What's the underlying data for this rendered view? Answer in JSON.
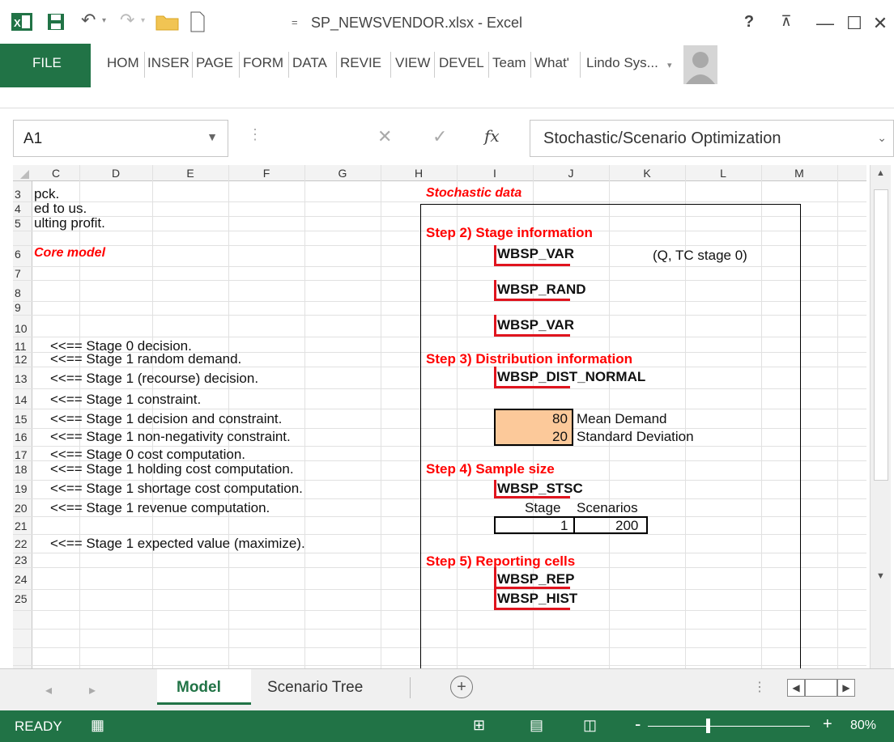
{
  "window": {
    "title": "SP_NEWSVENDOR.xlsx - Excel",
    "help": "?",
    "min": "—",
    "max": "☐",
    "close": "✕"
  },
  "ribbon": {
    "tabs": [
      "FILE",
      "HOM",
      "INSER",
      "PAGE",
      "FORM",
      "DATA",
      "REVIE",
      "VIEW",
      "DEVEL",
      "Team",
      "What'",
      "Lindo Sys..."
    ]
  },
  "formula_bar": {
    "name_box": "A1",
    "fx": "fx",
    "formula": "Stochastic/Scenario Optimization"
  },
  "grid": {
    "columns": [
      "C",
      "D",
      "E",
      "F",
      "G",
      "H",
      "I",
      "J",
      "K",
      "L",
      "M"
    ],
    "rows": [
      "3",
      "4",
      "5",
      "6",
      "7",
      "8",
      "9",
      "10",
      "11",
      "12",
      "13",
      "14",
      "15",
      "16",
      "17",
      "18",
      "19",
      "20",
      "21",
      "22",
      "23",
      "24",
      "25"
    ],
    "cells": {
      "c3": "pck.",
      "c4": "ed to us.",
      "c5": "ulting profit.",
      "c6": "Core model",
      "c11": "<<== Stage 0 decision.",
      "c12": "<<== Stage 1 random demand.",
      "c13": "<<== Stage 1 (recourse) decision.",
      "c14": "<<== Stage 1 constraint.",
      "c15": "<<== Stage 1 decision and constraint.",
      "c16": "<<== Stage 1 non-negativity constraint.",
      "c17": "<<== Stage 0 cost computation.",
      "c18": "<<== Stage 1 holding cost computation.",
      "c19": "<<== Stage 1 shortage cost computation.",
      "c20": "<<== Stage 1 revenue computation.",
      "c22": "<<== Stage 1 expected value (maximize).",
      "h3": "Stochastic data",
      "h5": "Step 2)  Stage information",
      "i6": "WBSP_VAR",
      "k6": "(Q, TC stage 0)",
      "i8": "WBSP_RAND",
      "i10": "WBSP_VAR",
      "h12": "Step 3) Distribution information",
      "i13": "WBSP_DIST_NORMAL",
      "i15": "80",
      "j15": "Mean Demand",
      "i16": "20",
      "j16": "Standard Deviation",
      "h18": "Step 4) Sample size",
      "i19": "WBSP_STSC",
      "i20": "Stage",
      "j20": "Scenarios",
      "i21": "1",
      "j21": "200",
      "h23": "Step 5) Reporting cells",
      "i24": "WBSP_REP",
      "i25": "WBSP_HIST"
    }
  },
  "sheets": {
    "active": "Model",
    "other": "Scenario Tree",
    "add": "+"
  },
  "status": {
    "text": "READY",
    "zoom": "80%"
  }
}
